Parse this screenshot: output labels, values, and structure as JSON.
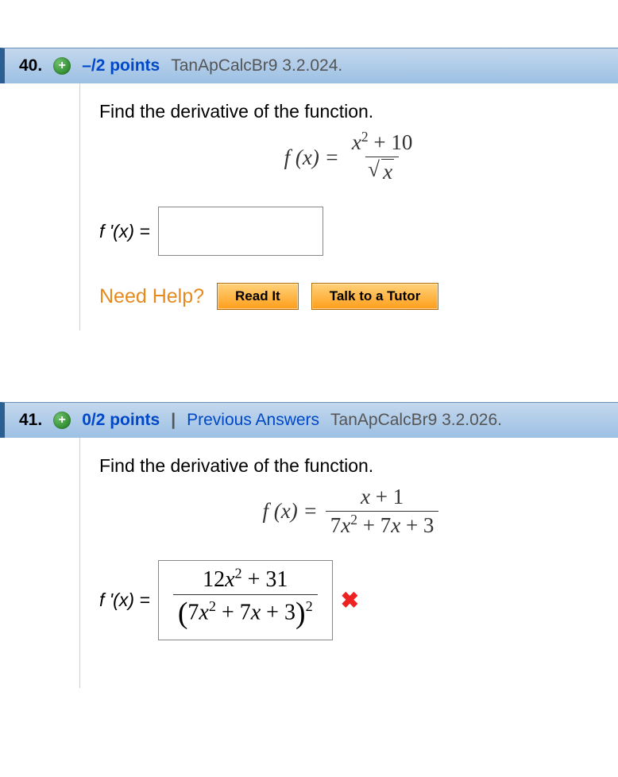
{
  "q40": {
    "number": "40.",
    "points": "–/2 points",
    "ref": "TanApCalcBr9 3.2.024.",
    "prompt": "Find the derivative of the function.",
    "formula_lhs": "f (x) =",
    "formula_num": "x² + 10",
    "formula_den_var": "x",
    "answer_lhs": "f '(x) =",
    "help_label": "Need Help?",
    "read_btn": "Read It",
    "tutor_btn": "Talk to a Tutor"
  },
  "q41": {
    "number": "41.",
    "points": "0/2 points",
    "prev_link": "Previous Answers",
    "ref": "TanApCalcBr9 3.2.026.",
    "prompt": "Find the derivative of the function.",
    "formula_lhs": "f (x) =",
    "formula_num": "x + 1",
    "formula_den": "7x² + 7x + 3",
    "answer_lhs": "f '(x) =",
    "ans_num": "12x² + 31",
    "ans_den_inner": "7x² + 7x + 3",
    "wrong": "✖"
  },
  "sep": "|"
}
